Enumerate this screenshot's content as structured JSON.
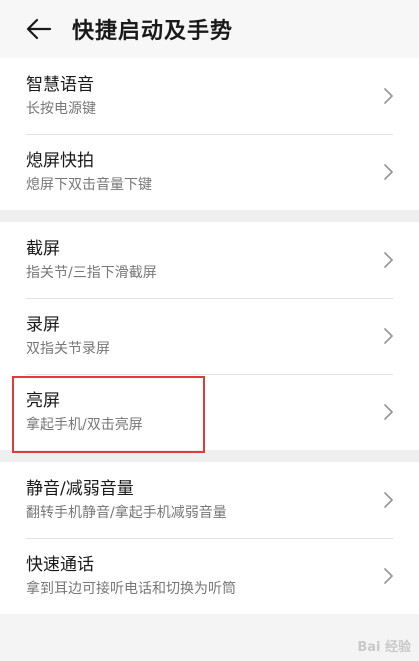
{
  "header": {
    "title": "快捷启动及手势"
  },
  "groups": [
    {
      "items": [
        {
          "title": "智慧语音",
          "subtitle": "长按电源键"
        },
        {
          "title": "熄屏快拍",
          "subtitle": "熄屏下双击音量下键"
        }
      ]
    },
    {
      "items": [
        {
          "title": "截屏",
          "subtitle": "指关节/三指下滑截屏"
        },
        {
          "title": "录屏",
          "subtitle": "双指关节录屏"
        },
        {
          "title": "亮屏",
          "subtitle": "拿起手机/双击亮屏"
        }
      ]
    },
    {
      "items": [
        {
          "title": "静音/减弱音量",
          "subtitle": "翻转手机静音/拿起手机减弱音量"
        },
        {
          "title": "快速通话",
          "subtitle": "拿到耳边可接听电话和切换为听筒"
        }
      ]
    }
  ],
  "watermark": "Bai 经验",
  "colors": {
    "highlight": "#e03a3a",
    "background": "#f4f4f4"
  }
}
